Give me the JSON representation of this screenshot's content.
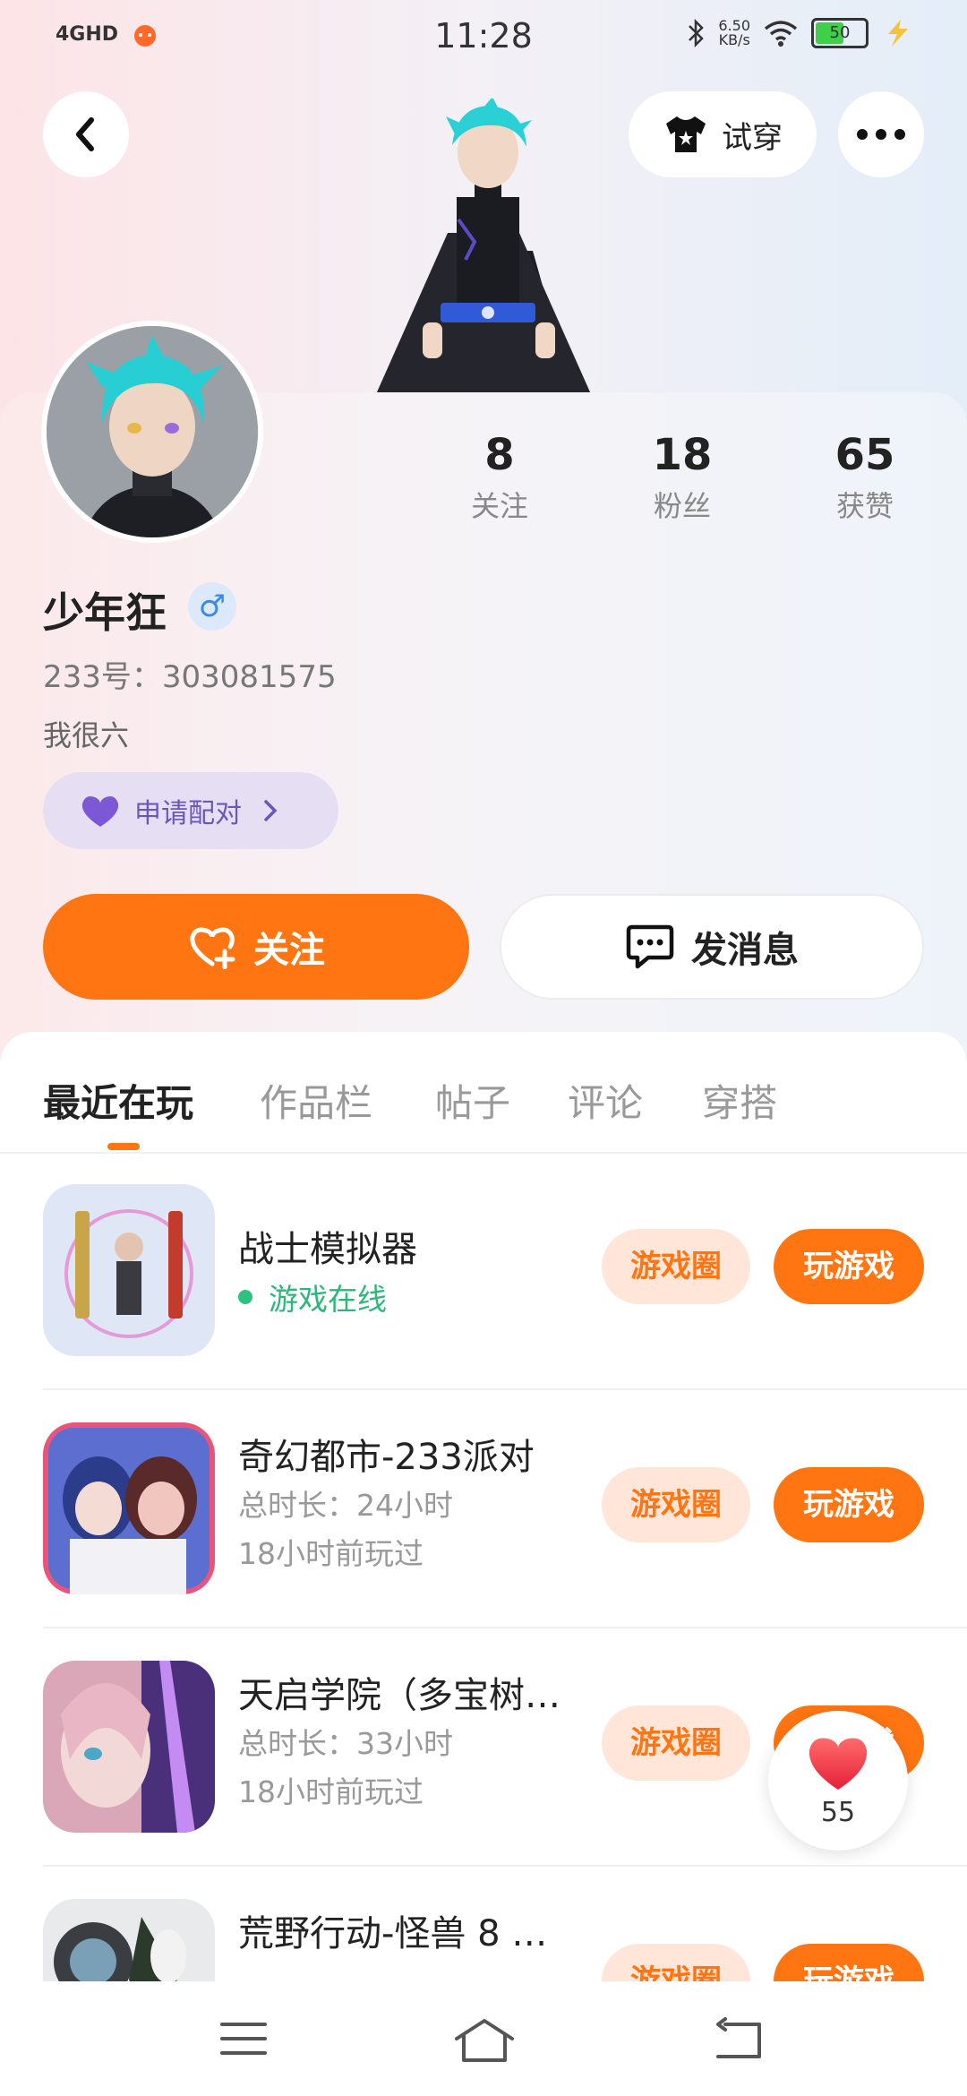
{
  "status_bar": {
    "network": "4GHD",
    "time": "11:28",
    "net_speed_value": "6.50",
    "net_speed_unit": "KB/s",
    "battery": "50"
  },
  "header": {
    "tryon_label": "试穿"
  },
  "profile": {
    "stats": [
      {
        "count": "8",
        "label": "关注"
      },
      {
        "count": "18",
        "label": "粉丝"
      },
      {
        "count": "65",
        "label": "获赞"
      }
    ],
    "username": "少年狂",
    "gender_symbol": "♂",
    "uid": "233号：303081575",
    "bio": "我很六",
    "pair_label": "申请配对",
    "follow_label": "关注",
    "message_label": "发消息"
  },
  "tabs": [
    {
      "label": "最近在玩"
    },
    {
      "label": "作品栏"
    },
    {
      "label": "帖子"
    },
    {
      "label": "评论"
    },
    {
      "label": "穿搭"
    }
  ],
  "games": [
    {
      "title": "战士模拟器",
      "status": "游戏在线",
      "circle_label": "游戏圈",
      "play_label": "玩游戏"
    },
    {
      "title": "奇幻都市-233派对",
      "duration": "总时长：24小时",
      "last_played": "18小时前玩过",
      "circle_label": "游戏圈",
      "play_label": "玩游戏"
    },
    {
      "title": "天启学院（多宝树…",
      "duration": "总时长：33小时",
      "last_played": "18小时前玩过",
      "circle_label": "游戏圈",
      "play_label": "玩游戏"
    },
    {
      "title": "荒野行动-怪兽 8 …",
      "circle_label": "游戏圈",
      "play_label": "玩游戏"
    }
  ],
  "floating_like": {
    "count": "55"
  },
  "colors": {
    "accent": "#ff7512",
    "online": "#2cb77b",
    "pair_bg": "#e6def3"
  },
  "icons": [
    "back-arrow-icon",
    "tshirt-icon",
    "more-dots-icon",
    "heart-plus-icon",
    "chat-bubble-icon",
    "heart-icon",
    "menu-icon",
    "home-icon",
    "back-nav-icon"
  ]
}
